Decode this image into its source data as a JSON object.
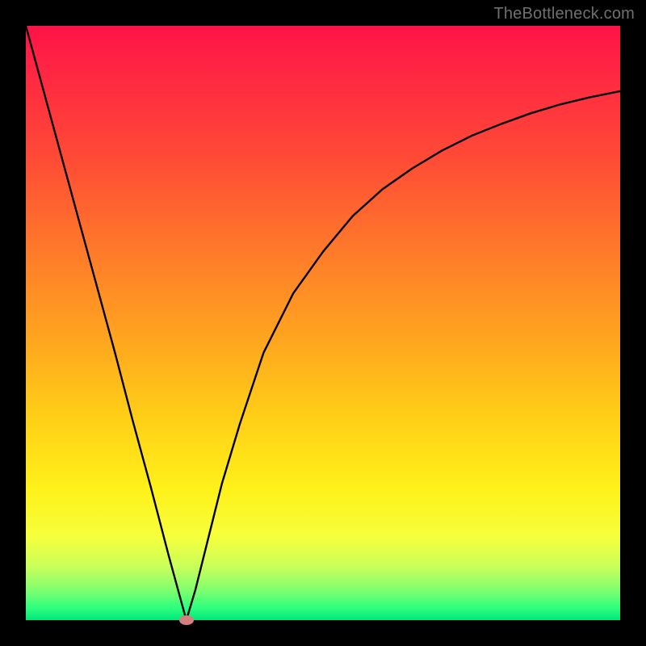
{
  "watermark": "TheBottleneck.com",
  "chart_data": {
    "type": "line",
    "title": "",
    "xlabel": "",
    "ylabel": "",
    "xlim": [
      0,
      100
    ],
    "ylim": [
      0,
      100
    ],
    "grid": false,
    "legend": false,
    "notes": "Background is a vertical gradient from red (top, high bottleneck) to green (bottom, no bottleneck). A black V-shaped curve touches 0 at x≈27 and rises asymptotically toward ~90 on the right. A small pink marker sits at the curve minimum.",
    "series": [
      {
        "name": "bottleneck_curve",
        "color": "#000000",
        "x": [
          0,
          3,
          6,
          9,
          12,
          15,
          18,
          21,
          24,
          25.5,
          27,
          28.5,
          30,
          33,
          36,
          40,
          45,
          50,
          55,
          60,
          65,
          70,
          75,
          80,
          85,
          90,
          95,
          100
        ],
        "y": [
          100,
          89,
          78,
          67,
          56,
          45,
          33.5,
          22.5,
          11,
          5.5,
          0,
          5,
          11,
          23,
          33,
          45,
          55,
          62,
          68,
          72.5,
          76,
          79,
          81.5,
          83.5,
          85.3,
          86.8,
          88,
          89
        ]
      }
    ],
    "marker": {
      "x": 27,
      "y": 0,
      "color": "#d67e7e"
    }
  },
  "colors": {
    "gradient_top": "#ff1347",
    "gradient_bottom": "#00e77a",
    "curve": "#000000",
    "marker": "#d67e7e",
    "frame": "#000000",
    "watermark": "#6f6f6f"
  }
}
